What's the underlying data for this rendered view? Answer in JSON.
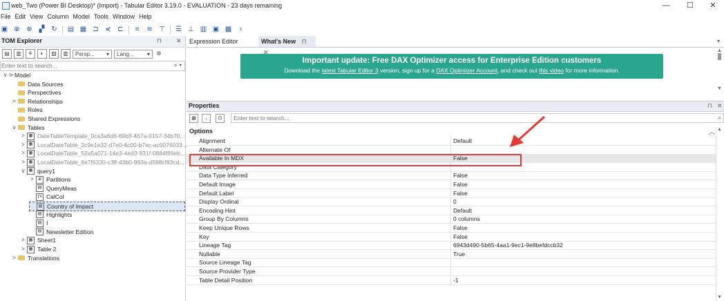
{
  "window": {
    "title": "web_Two (Power BI Desktop)* (Import) - Tabular Editor 3.19.0 - EVALUATION - 23 days remaining",
    "minimize": "—",
    "maximize": "☐",
    "close": "✕"
  },
  "menu": [
    "File",
    "Edit",
    "View",
    "Column",
    "Model",
    "Tools",
    "Window",
    "Help"
  ],
  "left_panel": {
    "title": "TOM Explorer",
    "pin": "⊓",
    "close": "✕",
    "perspective_select": "Persp...",
    "language_select": "Lang...",
    "search_placeholder": "Enter text to search...",
    "tree": [
      {
        "label": "Model",
        "level": 0,
        "expander": "∨",
        "icon": "model"
      },
      {
        "label": "Data Sources",
        "level": 1,
        "expander": "",
        "icon": "folder"
      },
      {
        "label": "Perspectives",
        "level": 1,
        "expander": "",
        "icon": "folder"
      },
      {
        "label": "Relationships",
        "level": 1,
        "expander": ">",
        "icon": "folder"
      },
      {
        "label": "Roles",
        "level": 1,
        "expander": "",
        "icon": "folder"
      },
      {
        "label": "Shared Expressions",
        "level": 1,
        "expander": "",
        "icon": "folder"
      },
      {
        "label": "Tables",
        "level": 1,
        "expander": "∨",
        "icon": "folder"
      },
      {
        "label": "DateTableTemplate_0ca3a6d6-69b3-467a-9157-34b70...",
        "level": 2,
        "expander": ">",
        "icon": "table",
        "dim": true
      },
      {
        "label": "LocalDateTable_2c9e1e32-d7e0-4c00-b7ec-ac0074033...",
        "level": 2,
        "expander": ">",
        "icon": "table",
        "dim": true
      },
      {
        "label": "LocalDateTable_52a5a071-14e3-4ed3-931f-0884f89eb...",
        "level": 2,
        "expander": ">",
        "icon": "table",
        "dim": true
      },
      {
        "label": "LocalDateTable_6e7f6330-c3ff-43b0-993a-d598cf83cd...",
        "level": 2,
        "expander": ">",
        "icon": "table",
        "dim": true
      },
      {
        "label": "query1",
        "level": 2,
        "expander": "∨",
        "icon": "table"
      },
      {
        "label": "Partitions",
        "level": 3,
        "expander": ">",
        "icon": "partition"
      },
      {
        "label": "QueryMeas",
        "level": 3,
        "expander": "",
        "icon": "measure"
      },
      {
        "label": "CalCol",
        "level": 3,
        "expander": "",
        "icon": "calccol"
      },
      {
        "label": "Country of Impact",
        "level": 3,
        "expander": "",
        "icon": "column",
        "selected": true
      },
      {
        "label": "Highlights",
        "level": 3,
        "expander": "",
        "icon": "column"
      },
      {
        "label": "I",
        "level": 3,
        "expander": "",
        "icon": "column"
      },
      {
        "label": "Newsletter Edition",
        "level": 3,
        "expander": "",
        "icon": "column"
      },
      {
        "label": "Sheet1",
        "level": 2,
        "expander": ">",
        "icon": "table"
      },
      {
        "label": "Table 2",
        "level": 2,
        "expander": ">",
        "icon": "table"
      },
      {
        "label": "Translations",
        "level": 1,
        "expander": ">",
        "icon": "folder"
      }
    ]
  },
  "tabs": [
    {
      "label": "Expression Editor",
      "active": false
    },
    {
      "label": "What's New",
      "active": true,
      "pin": "⊓",
      "close": "✕"
    }
  ],
  "banner": {
    "headline": "Important update: Free DAX Optimizer access for Enterprise Edition customers",
    "sub_prefix": "Download the ",
    "link1": "latest Tabular Editor 3",
    "sub_mid1": " version, sign up for a ",
    "link2": "DAX Optimizer Account",
    "sub_mid2": ", and check out ",
    "link3": "this video",
    "sub_suffix": " for more information.",
    "color": "#2aa58e"
  },
  "properties": {
    "title": "Properties",
    "search_placeholder": "Enter text to search...",
    "category": "Options",
    "rows": [
      {
        "key": "Alignment",
        "value": "Default"
      },
      {
        "key": "Alternate Of",
        "value": ""
      },
      {
        "key": "Available In MDX",
        "value": "False",
        "highlighted": true
      },
      {
        "key": "Data Category",
        "value": ""
      },
      {
        "key": "Data Type Inferred",
        "value": "False"
      },
      {
        "key": "Default Image",
        "value": "False"
      },
      {
        "key": "Default Label",
        "value": "False"
      },
      {
        "key": "Display Ordinal",
        "value": "0"
      },
      {
        "key": "Encoding Hint",
        "value": "Default"
      },
      {
        "key": "Group By Columns",
        "value": "0 columns"
      },
      {
        "key": "Keep Unique Rows",
        "value": "False"
      },
      {
        "key": "Key",
        "value": "False"
      },
      {
        "key": "Lineage Tag",
        "value": "6943d490-5b65-4aa1-9ec1-9e8befdccb32"
      },
      {
        "key": "Nullable",
        "value": "True"
      },
      {
        "key": "Source Lineage Tag",
        "value": ""
      },
      {
        "key": "Source Provider Type",
        "value": ""
      },
      {
        "key": "Table Detail Position",
        "value": "-1"
      }
    ]
  },
  "annotation_color": "#e53935"
}
